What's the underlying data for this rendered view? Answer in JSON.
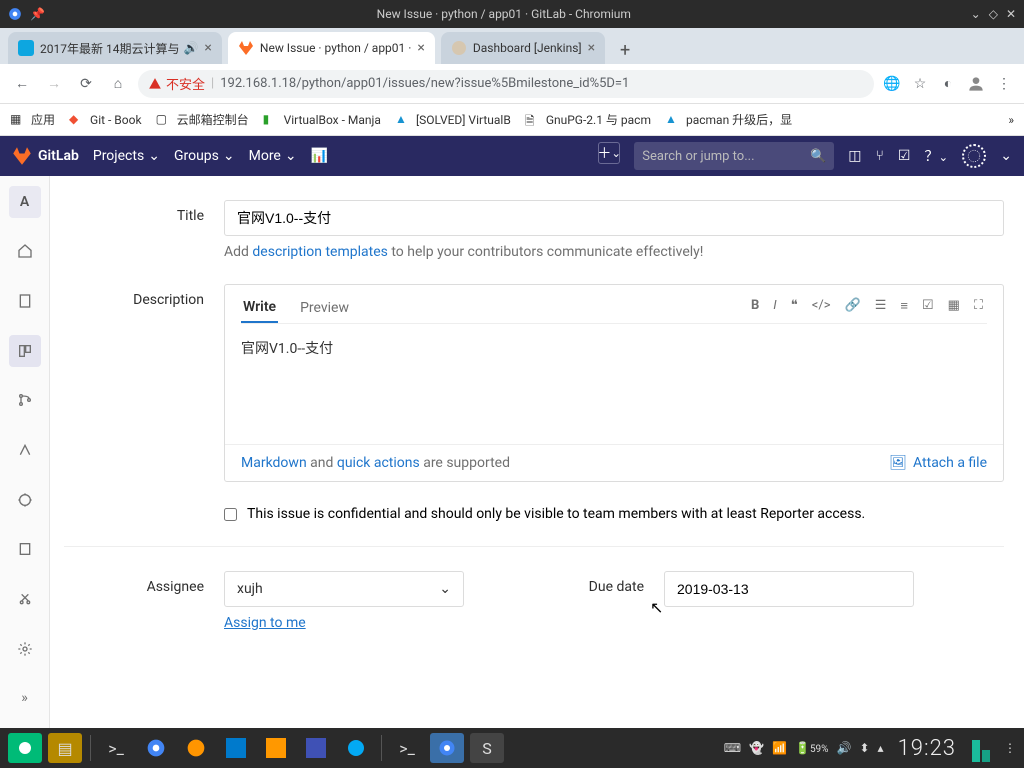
{
  "os": {
    "title": "New Issue · python / app01 · GitLab - Chromium"
  },
  "tabs": {
    "t1": "2017年最新 14期云计算与",
    "t2": "New Issue · python / app01 · ",
    "t3": "Dashboard [Jenkins]"
  },
  "addr": {
    "insecure": "不安全",
    "url": "192.168.1.18/python/app01/issues/new?issue%5Bmilestone_id%5D=1"
  },
  "bookmarks": {
    "apps": "应用",
    "b1": "Git - Book",
    "b2": "云邮箱控制台",
    "b3": "VirtualBox - Manja",
    "b4": "[SOLVED] VirtualB",
    "b5": "GnuPG-2.1 与 pacm",
    "b6": "pacman 升级后，显"
  },
  "gl": {
    "brand": "GitLab",
    "projects": "Projects",
    "groups": "Groups",
    "more": "More",
    "searchPlaceholder": "Search or jump to..."
  },
  "sidebar": {
    "avatar": "A"
  },
  "form": {
    "titleLabel": "Title",
    "titleValue": "官网V1.0--支付",
    "titleHintPrefix": "Add ",
    "titleHintLink": "description templates",
    "titleHintSuffix": " to help your contributors communicate effectively!",
    "descLabel": "Description",
    "writeTab": "Write",
    "previewTab": "Preview",
    "descValue": "官网V1.0--支付",
    "footerMarkdown": "Markdown",
    "footerAnd": " and ",
    "footerQuick": "quick actions",
    "footerEnd": " are supported",
    "attach": "Attach a file",
    "confidential": "This issue is confidential and should only be visible to team members with at least Reporter access.",
    "assigneeLabel": "Assignee",
    "assigneeValue": "xujh",
    "assignToMe": "Assign to me",
    "dueDateLabel": "Due date",
    "dueDateValue": "2019-03-13"
  },
  "tray": {
    "battery": "59%",
    "clock": "19:23"
  }
}
